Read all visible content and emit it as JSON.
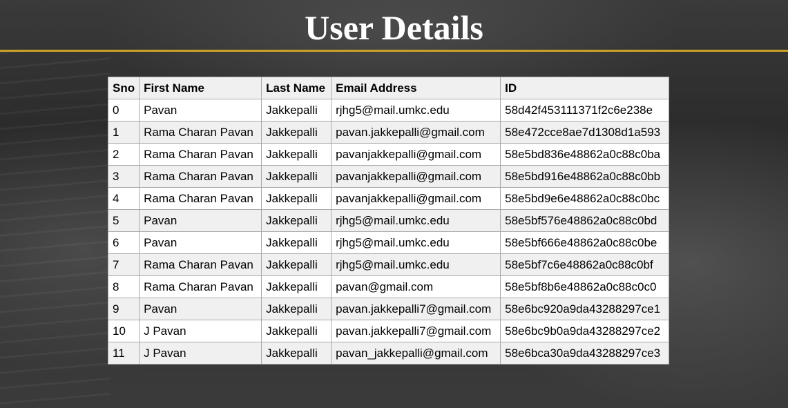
{
  "page": {
    "title": "User Details"
  },
  "theme": {
    "accent_line": "#c9a227",
    "header_row_bg": "#f0f0f0",
    "stripe_bg": "#f0f0f0"
  },
  "table": {
    "columns": [
      "Sno",
      "First Name",
      "Last Name",
      "Email Address",
      "ID"
    ],
    "rows": [
      {
        "sno": "0",
        "first": "Pavan",
        "last": "Jakkepalli",
        "email": "rjhg5@mail.umkc.edu",
        "id": "58d42f453111371f2c6e238e"
      },
      {
        "sno": "1",
        "first": "Rama Charan Pavan",
        "last": "Jakkepalli",
        "email": "pavan.jakkepalli@gmail.com",
        "id": "58e472cce8ae7d1308d1a593"
      },
      {
        "sno": "2",
        "first": "Rama Charan Pavan",
        "last": "Jakkepalli",
        "email": "pavanjakkepalli@gmail.com",
        "id": "58e5bd836e48862a0c88c0ba"
      },
      {
        "sno": "3",
        "first": "Rama Charan Pavan",
        "last": "Jakkepalli",
        "email": "pavanjakkepalli@gmail.com",
        "id": "58e5bd916e48862a0c88c0bb"
      },
      {
        "sno": "4",
        "first": "Rama Charan Pavan",
        "last": "Jakkepalli",
        "email": "pavanjakkepalli@gmail.com",
        "id": "58e5bd9e6e48862a0c88c0bc"
      },
      {
        "sno": "5",
        "first": "Pavan",
        "last": "Jakkepalli",
        "email": "rjhg5@mail.umkc.edu",
        "id": "58e5bf576e48862a0c88c0bd"
      },
      {
        "sno": "6",
        "first": "Pavan",
        "last": "Jakkepalli",
        "email": "rjhg5@mail.umkc.edu",
        "id": "58e5bf666e48862a0c88c0be"
      },
      {
        "sno": "7",
        "first": "Rama Charan Pavan",
        "last": "Jakkepalli",
        "email": "rjhg5@mail.umkc.edu",
        "id": "58e5bf7c6e48862a0c88c0bf"
      },
      {
        "sno": "8",
        "first": "Rama Charan Pavan",
        "last": "Jakkepalli",
        "email": "pavan@gmail.com",
        "id": "58e5bf8b6e48862a0c88c0c0"
      },
      {
        "sno": "9",
        "first": "Pavan",
        "last": "Jakkepalli",
        "email": "pavan.jakkepalli7@gmail.com",
        "id": "58e6bc920a9da43288297ce1"
      },
      {
        "sno": "10",
        "first": "J Pavan",
        "last": "Jakkepalli",
        "email": "pavan.jakkepalli7@gmail.com",
        "id": "58e6bc9b0a9da43288297ce2"
      },
      {
        "sno": "11",
        "first": "J Pavan",
        "last": "Jakkepalli",
        "email": "pavan_jakkepalli@gmail.com",
        "id": "58e6bca30a9da43288297ce3"
      }
    ]
  }
}
